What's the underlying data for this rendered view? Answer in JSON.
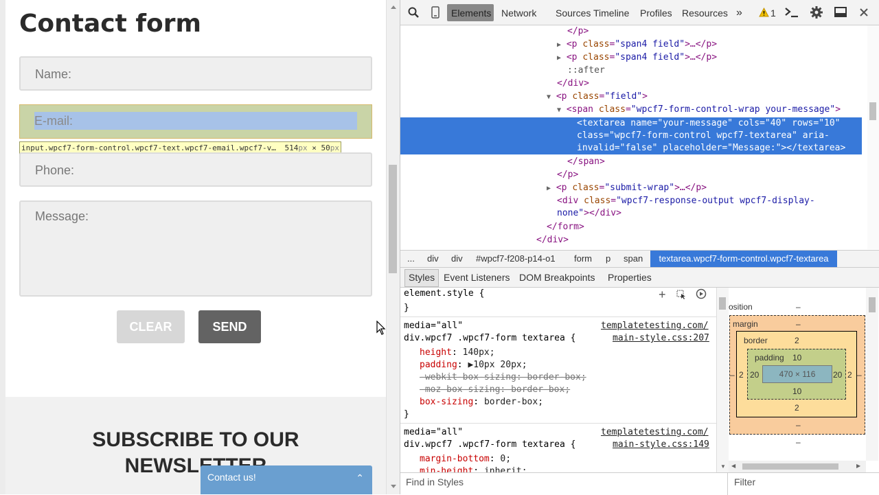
{
  "page": {
    "form_title": "Contact form",
    "name_placeholder": "Name:",
    "email_placeholder": "E-mail:",
    "phone_placeholder": "Phone:",
    "message_placeholder": "Message:",
    "clear_label": "CLEAR",
    "send_label": "SEND",
    "tooltip_selector": "input.wpcf7-form-control.wpcf7-text.wpcf7-email.wpcf7-v…",
    "tooltip_size_w": "514",
    "tooltip_size_unit1": "px",
    "tooltip_size_x": " × ",
    "tooltip_size_h": "50",
    "tooltip_size_unit2": "px",
    "subscribe_line1": "SUBSCRIBE TO OUR",
    "subscribe_line2": "NEWSLETTER",
    "contact_widget_label": "Contact us!",
    "contact_widget_chevron": "⌃"
  },
  "devtools": {
    "tabs": [
      "Elements",
      "Network",
      "Sources",
      "Timeline",
      "Profiles",
      "Resources"
    ],
    "overflow": "»",
    "warning_count": "1",
    "breadcrumbs": [
      "...",
      "div",
      "div",
      "#wpcf7-f208-p14-o1",
      "form",
      "p",
      "span",
      "textarea.wpcf7-form-control.wpcf7-textarea"
    ],
    "subtabs": [
      "Styles",
      "Event Listeners",
      "DOM Breakpoints",
      "Properties"
    ],
    "find_in_styles": "Find in Styles",
    "filter_placeholder": "Filter",
    "dom": {
      "l1": "</p>",
      "l2_tag": "<p",
      "l2_an": "class",
      "l2_av": "\"span4 field\"",
      "l2_rest": ">…</p>",
      "l3_tag": "<p",
      "l3_an": "class",
      "l3_av": "\"span4 field\"",
      "l3_rest": ">…</p>",
      "l4": "::after",
      "l5": "</div>",
      "l6_tag": "<p",
      "l6_an": "class",
      "l6_av": "\"field\"",
      "l6_rest": ">",
      "l7_tag": "<span",
      "l7_an": "class",
      "l7_av": "\"wpcf7-form-control-wrap your-message\"",
      "l7_rest": ">",
      "sel1": "<textarea name=\"your-message\" cols=\"40\" rows=\"10\"",
      "sel2": "class=\"wpcf7-form-control wpcf7-textarea\" aria-",
      "sel3": "invalid=\"false\" placeholder=\"Message:\"></textarea>",
      "l8": "</span>",
      "l9": "</p>",
      "l10_tag": "<p",
      "l10_an": "class",
      "l10_av": "\"submit-wrap\"",
      "l10_rest": ">…</p>",
      "l11_tag": "<div",
      "l11_an": "class",
      "l11_av": "\"wpcf7-response-output wpcf7-display-",
      "l12_av": "none\"",
      "l12_rest": "></div>",
      "l13": "</form>",
      "l14": "</div>"
    },
    "styles": {
      "element_style": "element.style {",
      "close_brace": "}",
      "rule1_media": "media=\"all\"",
      "rule1_selector": "div.wpcf7 .wpcf7-form textarea {",
      "rule1_source_host": "templatetesting.com/",
      "rule1_source_file": "main-style.css:207",
      "rule1_props": [
        {
          "name": "height",
          "value": "140px;"
        },
        {
          "name": "padding",
          "value": "▶10px 20px;"
        },
        {
          "name": "-webkit-box-sizing",
          "value": "border-box;"
        },
        {
          "name": "-moz-box-sizing",
          "value": "border-box;"
        },
        {
          "name": "box-sizing",
          "value": "border-box;"
        }
      ],
      "rule2_media": "media=\"all\"",
      "rule2_selector": "div.wpcf7 .wpcf7-form textarea {",
      "rule2_source_host": "templatetesting.com/",
      "rule2_source_file": "main-style.css:149",
      "rule2_props": [
        {
          "name": "margin-bottom",
          "value": "0;"
        },
        {
          "name": "min-height",
          "value": "inherit;"
        }
      ]
    },
    "boxmodel": {
      "position_label": "osition",
      "position_val": "–",
      "margin_label": "margin",
      "margin_val": "–",
      "border_label": "border",
      "border_top": "2",
      "border_left": "2",
      "border_right": "2",
      "border_bottom": "2",
      "padding_label": "padding",
      "padding_top": "10",
      "padding_left": "20",
      "padding_right": "20",
      "padding_bottom": "10",
      "content": "470 × 116",
      "margin_left": "–",
      "margin_right": "–",
      "margin_bottom": "–",
      "position_bottom": "–"
    }
  }
}
